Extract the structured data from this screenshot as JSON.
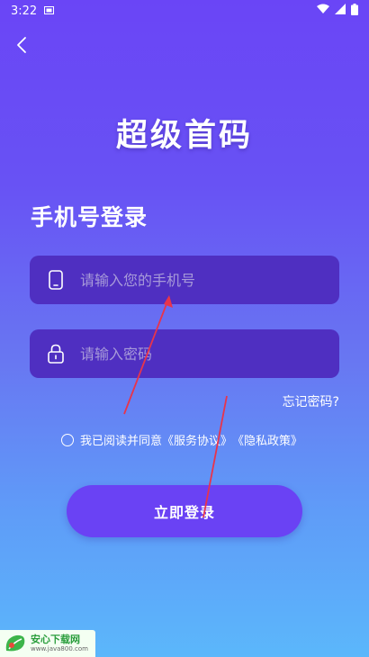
{
  "status_bar": {
    "time": "3:22"
  },
  "header": {
    "app_title": "超级首码"
  },
  "login": {
    "heading": "手机号登录",
    "phone_placeholder": "请输入您的手机号",
    "password_placeholder": "请输入密码",
    "forgot_password": "忘记密码?",
    "agreement_prefix": "我已阅读并同意",
    "service_agreement": "《服务协议》",
    "privacy_policy": "《隐私政策》",
    "submit": "立即登录"
  },
  "watermark": {
    "title": "安心下载网",
    "url": "www.java800.com"
  },
  "colors": {
    "background_top": "#6a45f6",
    "background_bottom": "#5bb7fb",
    "field_background": "#4f2fc1",
    "button_background": "#6a42f4",
    "annotation_arrow": "#e8344b"
  },
  "icons": [
    "signal-bar-icon",
    "wifi-icon",
    "battery-icon",
    "back-icon",
    "phone-icon",
    "lock-icon"
  ]
}
